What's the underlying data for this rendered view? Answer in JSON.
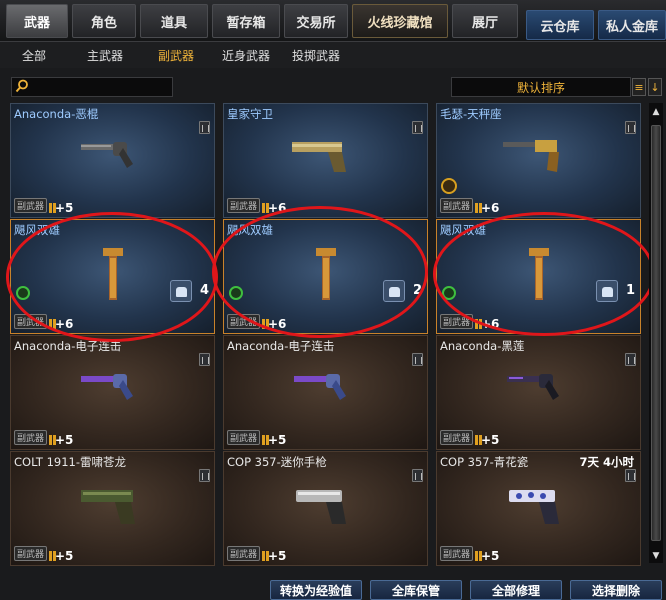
{
  "tabs": [
    {
      "label": "武器",
      "active": true
    },
    {
      "label": "角色"
    },
    {
      "label": "道具"
    },
    {
      "label": "暂存箱"
    },
    {
      "label": "交易所"
    },
    {
      "label": "火线珍藏馆"
    },
    {
      "label": "展厅"
    }
  ],
  "storage_tabs": [
    "云仓库",
    "私人金库"
  ],
  "sub_tabs": [
    "全部",
    "主武器",
    "副武器",
    "近身武器",
    "投掷武器"
  ],
  "search": {
    "placeholder": ""
  },
  "sort": {
    "label": "默认排序",
    "list_icon": "list-icon",
    "arrow_icon": "sort-arrow-icon"
  },
  "items": [
    {
      "name": "Anaconda-恶棍",
      "tag": "副武器",
      "ammo": "+5",
      "style": "blue",
      "weapon_icon": "revolver-icon"
    },
    {
      "name": "皇家守卫",
      "tag": "副武器",
      "ammo": "+6",
      "style": "blue",
      "weapon_icon": "pistol-gold-icon"
    },
    {
      "name": "毛瑟-天秤座",
      "tag": "副武器",
      "ammo": "+6",
      "style": "blue",
      "weapon_icon": "mauser-icon"
    },
    {
      "name": "飓风双雄",
      "tag": "副武器",
      "ammo": "+6",
      "count": "4",
      "style": "orange",
      "weapon_icon": "smg-gold-icon"
    },
    {
      "name": "飓风双雄",
      "tag": "副武器",
      "ammo": "+6",
      "count": "2",
      "style": "orange",
      "weapon_icon": "smg-gold-icon"
    },
    {
      "name": "飓风双雄",
      "tag": "副武器",
      "ammo": "+6",
      "count": "1",
      "style": "orange",
      "weapon_icon": "smg-gold-icon"
    },
    {
      "name": "Anaconda-电子连击",
      "tag": "副武器",
      "ammo": "+5",
      "style": "brown",
      "weapon_icon": "revolver-purple-icon"
    },
    {
      "name": "Anaconda-电子连击",
      "tag": "副武器",
      "ammo": "+5",
      "style": "brown",
      "weapon_icon": "revolver-purple-icon"
    },
    {
      "name": "Anaconda-黑莲",
      "tag": "副武器",
      "ammo": "+5",
      "style": "brown",
      "weapon_icon": "revolver-dark-icon"
    },
    {
      "name": "COLT 1911-雷啸苍龙",
      "tag": "副武器",
      "ammo": "+5",
      "style": "brown",
      "weapon_icon": "pistol-green-icon"
    },
    {
      "name": "COP 357-迷你手枪",
      "tag": "副武器",
      "ammo": "+5",
      "style": "brown",
      "weapon_icon": "cop-silver-icon"
    },
    {
      "name": "COP 357-青花瓷",
      "tag": "副武器",
      "ammo": "+5",
      "style": "brown",
      "weapon_icon": "cop-porcelain-icon",
      "time": "7天 4小时"
    }
  ],
  "actions": [
    "转换为经验值",
    "全库保管",
    "全部修理",
    "选择删除"
  ],
  "colors": {
    "highlight_circle": "#e0161a",
    "active_subtab": "#f0b43a",
    "name_blue": "#9ecbff"
  }
}
